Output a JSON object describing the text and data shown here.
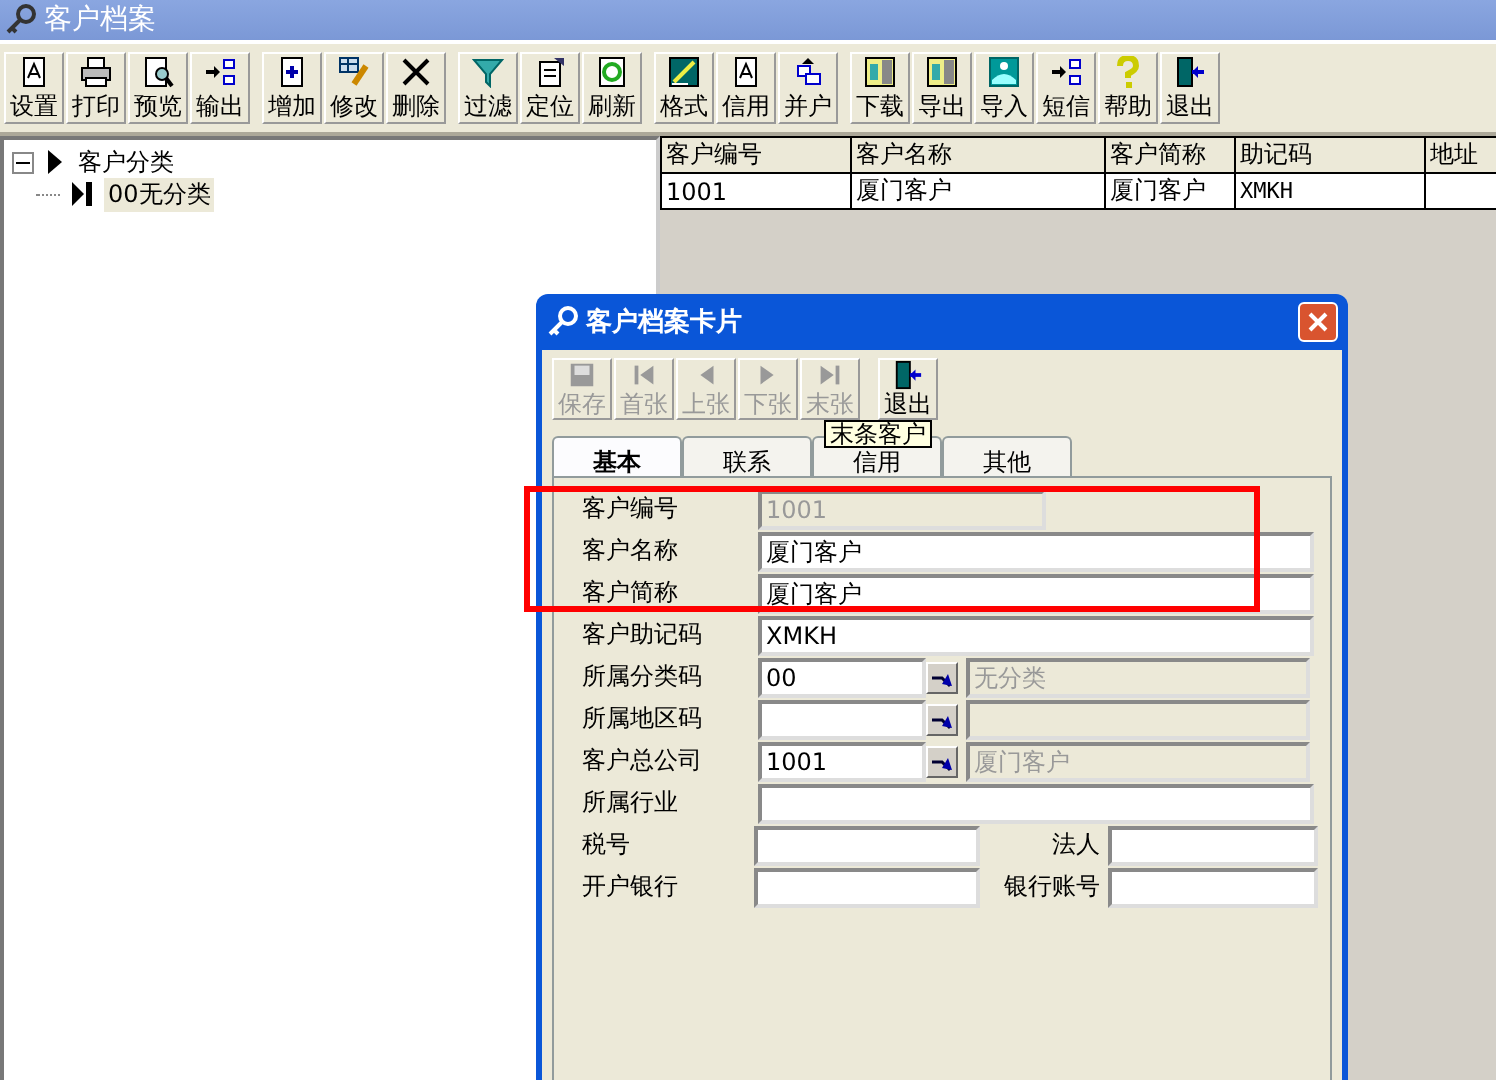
{
  "window": {
    "title": "客户档案"
  },
  "toolbar": [
    [
      "设置",
      "打印",
      "预览",
      "输出"
    ],
    [
      "增加",
      "修改",
      "删除"
    ],
    [
      "过滤",
      "定位",
      "刷新"
    ],
    [
      "格式",
      "信用",
      "并户"
    ],
    [
      "下载",
      "导出",
      "导入",
      "短信",
      "帮助",
      "退出"
    ]
  ],
  "tree": [
    {
      "label": "客户分类",
      "expanded": true,
      "selected": false,
      "children": [
        {
          "label": "00无分类",
          "selected": true
        }
      ]
    }
  ],
  "table": {
    "columns": [
      "客户编号",
      "客户名称",
      "客户简称",
      "助记码",
      "地址"
    ],
    "rows": [
      [
        "1001",
        "厦门客户",
        "厦门客户",
        "XMKH"
      ]
    ]
  },
  "dialog": {
    "title": "客户档案卡片",
    "toolbar": [
      {
        "label": "保存",
        "disabled": true
      },
      {
        "label": "首张",
        "disabled": true
      },
      {
        "label": "上张",
        "disabled": true
      },
      {
        "label": "下张",
        "disabled": true
      },
      {
        "label": "末张",
        "disabled": true
      },
      {
        "label": "退出",
        "disabled": false
      }
    ],
    "tooltip": "末条客户",
    "tabs": [
      {
        "label": "基本",
        "selected": true
      },
      {
        "label": "联系",
        "selected": false
      },
      {
        "label": "信用",
        "selected": false
      },
      {
        "label": "其他",
        "selected": false
      }
    ],
    "fields": [
      {
        "kind": "short",
        "label": "客户编号",
        "value": "1001",
        "disabled": true
      },
      {
        "kind": "text",
        "label": "客户名称",
        "value": "厦门客户"
      },
      {
        "kind": "text",
        "label": "客户简称",
        "value": "厦门客户"
      },
      {
        "kind": "text",
        "label": "客户助记码",
        "value": "XMKH"
      },
      {
        "kind": "lookup",
        "label": "所属分类码",
        "value": "00",
        "name": "无分类"
      },
      {
        "kind": "lookup",
        "label": "所属地区码"
      },
      {
        "kind": "lookup",
        "label": "客户总公司",
        "value": "1001",
        "name": "厦门客户"
      },
      {
        "kind": "text",
        "label": "所属行业"
      },
      {
        "kind": "pair",
        "label": "税号",
        "label2": "法人"
      },
      {
        "kind": "pair",
        "label": "开户银行",
        "label2": "银行账号"
      }
    ]
  }
}
